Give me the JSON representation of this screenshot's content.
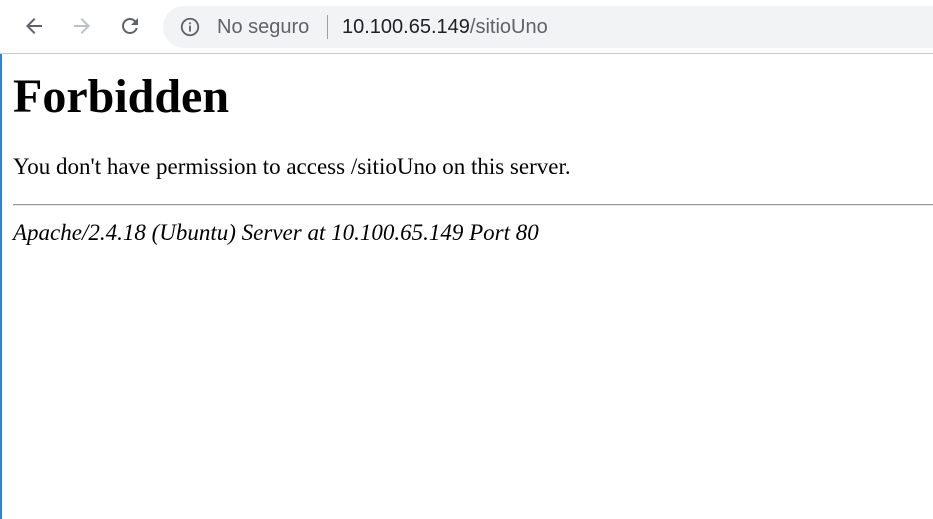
{
  "browser": {
    "toolbar": {
      "back_icon": "arrow-left-icon",
      "forward_icon": "arrow-right-icon",
      "reload_icon": "reload-icon"
    },
    "omnibox": {
      "security_icon": "info-circle-icon",
      "security_label": "No seguro",
      "url_host": "10.100.65.149",
      "url_path": "/sitioUno"
    }
  },
  "page": {
    "title": "Forbidden",
    "message": "You don't have permission to access /sitioUno on this server.",
    "server_signature": "Apache/2.4.18 (Ubuntu) Server at 10.100.65.149 Port 80"
  },
  "colors": {
    "omnibox_bg": "#f1f3f4",
    "icon_active": "#5f6368",
    "icon_disabled": "#bdc1c6",
    "text": "#000000"
  }
}
